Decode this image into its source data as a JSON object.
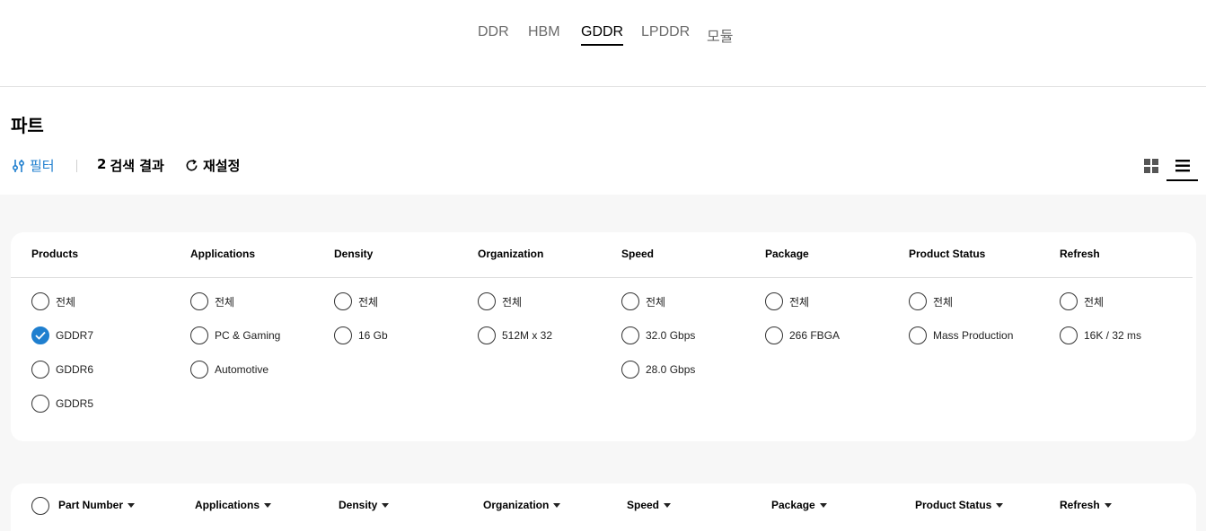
{
  "tabs": [
    {
      "label": "DDR",
      "active": false
    },
    {
      "label": "HBM",
      "active": false
    },
    {
      "label": "GDDR",
      "active": true
    },
    {
      "label": "LPDDR",
      "active": false
    },
    {
      "label": "모듈",
      "active": false
    }
  ],
  "page_title": "파트",
  "toolbar": {
    "filter_label": "필터",
    "result_count": "2",
    "result_label": "검색 결과",
    "reset_label": "재설정"
  },
  "filters": {
    "products": {
      "title": "Products",
      "options": [
        "전체",
        "GDDR7",
        "GDDR6",
        "GDDR5"
      ],
      "selected": "GDDR7"
    },
    "applications": {
      "title": "Applications",
      "options": [
        "전체",
        "PC & Gaming",
        "Automotive"
      ]
    },
    "density": {
      "title": "Density",
      "options": [
        "전체",
        "16 Gb"
      ]
    },
    "organization": {
      "title": "Organization",
      "options": [
        "전체",
        "512M x 32"
      ]
    },
    "speed": {
      "title": "Speed",
      "options": [
        "전체",
        "32.0 Gbps",
        "28.0 Gbps"
      ]
    },
    "package": {
      "title": "Package",
      "options": [
        "전체",
        "266 FBGA"
      ]
    },
    "product_status": {
      "title": "Product Status",
      "options": [
        "전체",
        "Mass Production"
      ]
    },
    "refresh": {
      "title": "Refresh",
      "options": [
        "전체",
        "16K / 32 ms"
      ]
    }
  },
  "table": {
    "columns": [
      "Part Number",
      "Applications",
      "Density",
      "Organization",
      "Speed",
      "Package",
      "Product Status",
      "Refresh"
    ]
  },
  "colors": {
    "accent": "#1f7fcf",
    "background_gray": "#f7f7f7"
  }
}
